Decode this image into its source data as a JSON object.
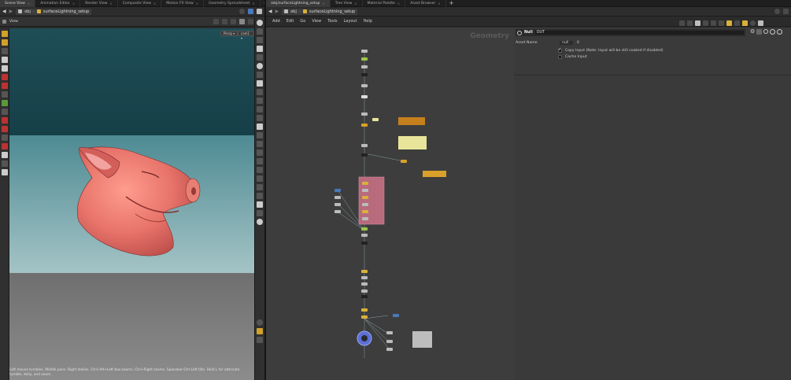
{
  "left_tabs": [
    "Scene View",
    "Animation Editor",
    "Render View",
    "Composite View",
    "Motion FX View",
    "Geometry Spreadsheet"
  ],
  "right_tabs": [
    "/obj/surfaceLightning_setup",
    "Tree View",
    "Material Palette",
    "Asset Browser"
  ],
  "left_path": {
    "root": "obj",
    "node": "surfaceLightning_setup"
  },
  "right_path": {
    "root": "obj",
    "node": "surfaceLightning_setup"
  },
  "viewport": {
    "label": "View",
    "persp_button": "Persp ▾",
    "cam_button": "cam1 ▾",
    "hint": "Left mouse tumbles. Middle pans. Right dollies. Ctrl+Alt+Left box-zooms. Ctrl+Right zooms. Spacebar-Ctrl-Left tilts. Hold L for alternate tumble, dolly, and zoom."
  },
  "menu": [
    "Add",
    "Edit",
    "Go",
    "View",
    "Tools",
    "Layout",
    "Help"
  ],
  "network": {
    "context_label": "Geometry"
  },
  "params": {
    "node_type": "Null",
    "node_name": "OUT",
    "asset_name_label": "Asset Name",
    "asset_name_value": "null",
    "asset_version": "0",
    "copy_input_label": "Copy Input (Note: Input will be still cooked if disabled)",
    "copy_input_checked": true,
    "cache_input_label": "Cache Input",
    "cache_input_checked": false
  },
  "colors": {
    "sky_top": "#1f4e57",
    "sky_bottom": "#a4c4c6",
    "ground_top": "#6f6f6f",
    "ground_bottom": "#8c8c8c",
    "network_bg": "#3d3d3d",
    "accent_yellow": "#d9b13a",
    "sticky_orange": "#c57f1c",
    "sticky_yellow": "#e8e59a",
    "network_box_pink": "#b86b7d"
  }
}
